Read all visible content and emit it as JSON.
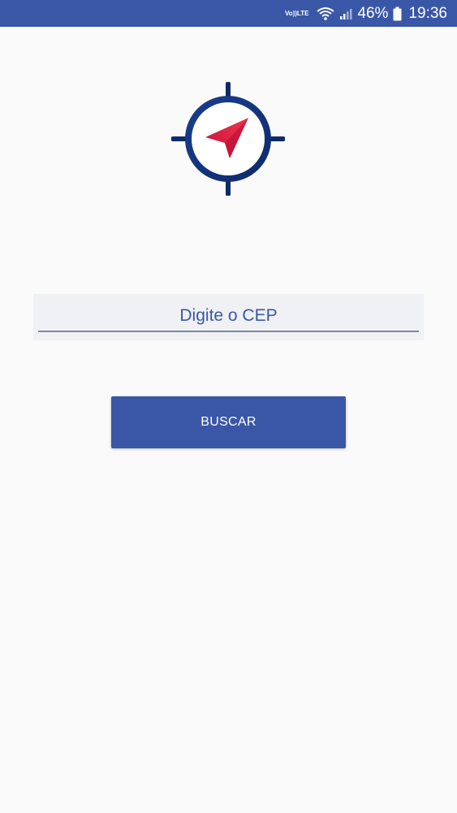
{
  "status_bar": {
    "volte_top": "Vo))",
    "volte_bottom": "LTE",
    "battery_percent": "46%",
    "time": "19:36",
    "icons": [
      "volte-icon",
      "wifi-icon",
      "signal-icon",
      "battery-icon"
    ]
  },
  "main": {
    "logo_icon": "location-compass-icon",
    "cep_input": {
      "placeholder": "Digite o CEP",
      "value": ""
    },
    "search_button_label": "BUSCAR"
  },
  "colors": {
    "primary": "#3a57a7",
    "background": "#fafafa",
    "input_background": "#f0f1f5",
    "logo_pointer": "#e8233f",
    "logo_ring": "#1e3f8f"
  }
}
